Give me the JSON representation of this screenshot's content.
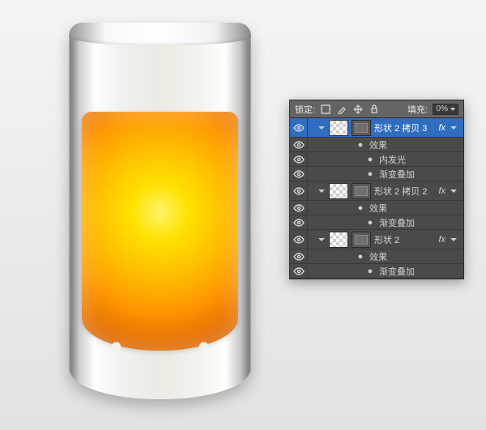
{
  "header": {
    "lock_label": "锁定:",
    "fill_label": "填充:",
    "fill_value": "0%"
  },
  "layers": [
    {
      "name": "形状 2 拷贝 3",
      "selected": true,
      "fx_label": "效果",
      "effects": [
        "内发光",
        "渐变叠加"
      ]
    },
    {
      "name": "形状 2 拷贝 2",
      "selected": false,
      "fx_label": "效果",
      "effects": [
        "渐变叠加"
      ]
    },
    {
      "name": "形状 2",
      "selected": false,
      "fx_label": "效果",
      "effects": [
        "渐变叠加"
      ]
    }
  ],
  "fx_tag": "fx"
}
